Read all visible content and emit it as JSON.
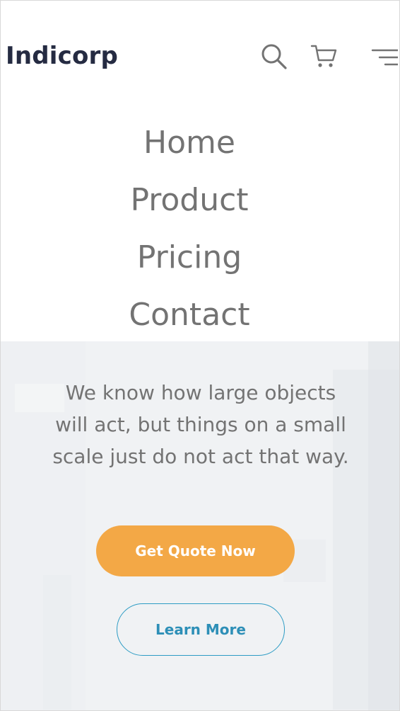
{
  "header": {
    "logo": "Indicorp",
    "icons": [
      "search-icon",
      "cart-icon",
      "hamburger-menu-icon"
    ]
  },
  "nav": {
    "items": [
      {
        "label": "Home"
      },
      {
        "label": "Product"
      },
      {
        "label": "Pricing"
      },
      {
        "label": "Contact"
      }
    ]
  },
  "hero": {
    "description": "We know how large objects will act, but things on a small scale just do not act that way.",
    "primary_button": "Get Quote Now",
    "secondary_button": "Learn More"
  },
  "colors": {
    "brand_dark": "#252b42",
    "text_muted": "#737373",
    "accent_orange": "#f3a846",
    "accent_blue": "#2d9cc4"
  }
}
